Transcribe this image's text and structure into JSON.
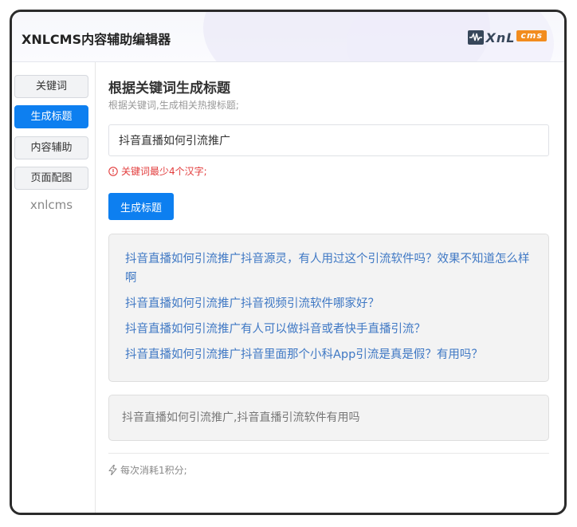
{
  "app": {
    "title": "XNLCMS内容辅助编辑器",
    "logo": {
      "text": "XnL",
      "badge": "cms",
      "icon": "waveform-icon"
    }
  },
  "sidebar": {
    "items": [
      {
        "label": "关键词",
        "active": false
      },
      {
        "label": "生成标题",
        "active": true
      },
      {
        "label": "内容辅助",
        "active": false
      },
      {
        "label": "页面配图",
        "active": false
      }
    ],
    "footer_label": "xnlcms"
  },
  "main": {
    "title": "根据关键词生成标题",
    "subtitle": "根据关键词,生成相关热搜标题;",
    "keyword_input": {
      "value": "抖音直播如何引流推广",
      "placeholder": ""
    },
    "error": {
      "icon": "info-circle-icon",
      "text": "关键词最少4个汉字;"
    },
    "generate_button": "生成标题",
    "results": [
      "抖音直播如何引流推广抖音源灵，有人用过这个引流软件吗？效果不知道怎么样啊",
      "抖音直播如何引流推广抖音视频引流软件哪家好？",
      "抖音直播如何引流推广有人可以做抖音或者快手直播引流？",
      "抖音直播如何引流推广抖音里面那个小科App引流是真是假？有用吗？"
    ],
    "summary": "抖音直播如何引流推广,抖音直播引流软件有用吗",
    "cost": {
      "icon": "lightning-icon",
      "text": "每次消耗1积分;"
    }
  },
  "colors": {
    "accent": "#0d7ff0",
    "link": "#3f78c4",
    "error": "#e23c3c",
    "logo_dark": "#37475a",
    "logo_badge": "#f28c1e"
  }
}
